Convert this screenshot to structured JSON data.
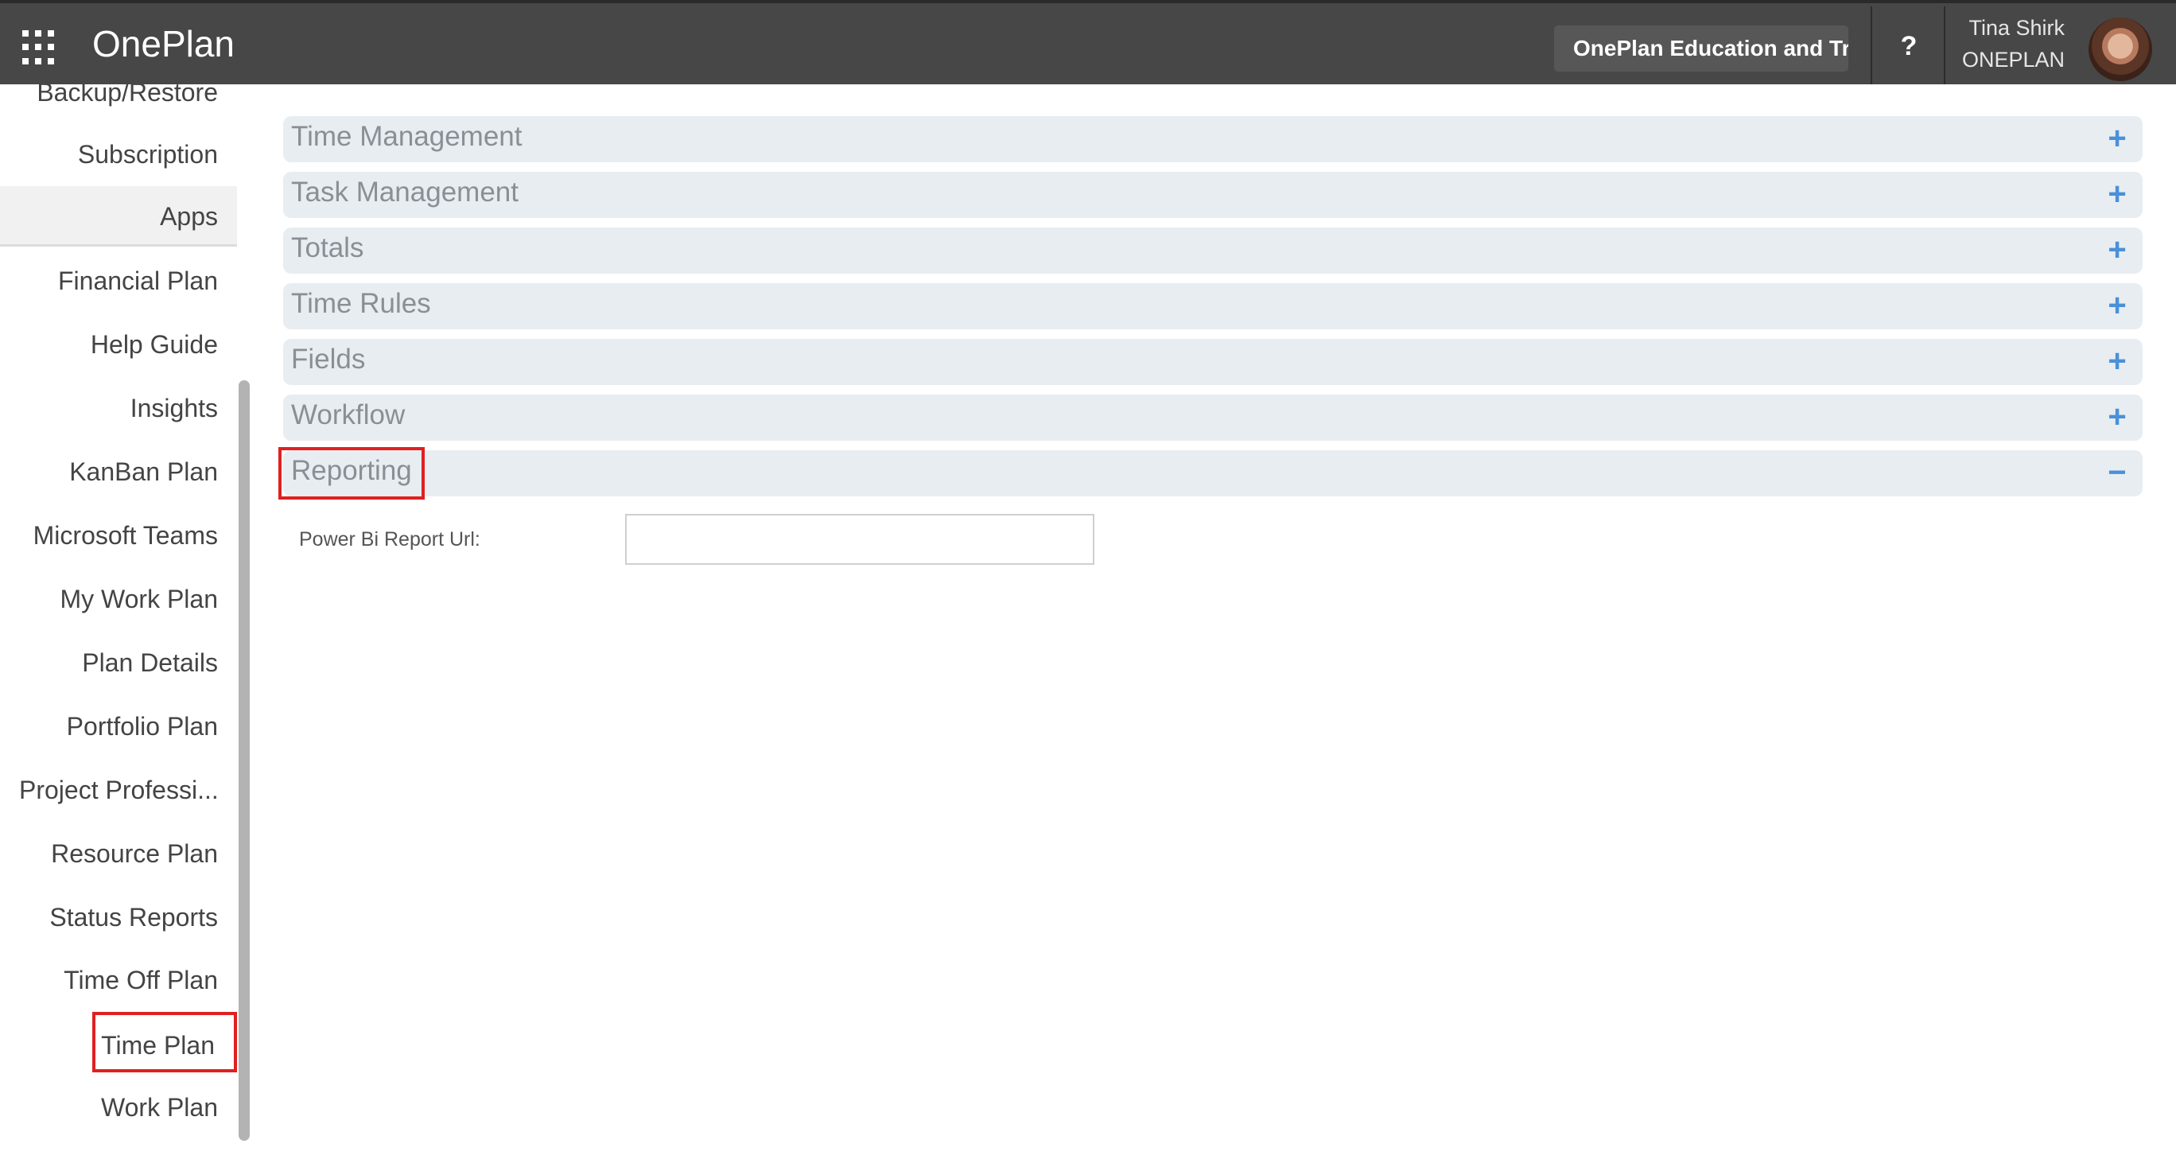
{
  "header": {
    "app_name": "OnePlan",
    "tenant": "OnePlan Education and Trai",
    "help_label": "?",
    "user_name": "Tina Shirk",
    "user_org": "ONEPLAN"
  },
  "sidebar": {
    "items": [
      {
        "label": "Backup/Restore"
      },
      {
        "label": "Subscription"
      },
      {
        "label": "Apps"
      },
      {
        "label": "Financial Plan"
      },
      {
        "label": "Help Guide"
      },
      {
        "label": "Insights"
      },
      {
        "label": "KanBan Plan"
      },
      {
        "label": "Microsoft Teams"
      },
      {
        "label": "My Work Plan"
      },
      {
        "label": "Plan Details"
      },
      {
        "label": "Portfolio Plan"
      },
      {
        "label": "Project Professi..."
      },
      {
        "label": "Resource Plan"
      },
      {
        "label": "Status Reports"
      },
      {
        "label": "Time Off Plan"
      },
      {
        "label": "Time Plan"
      },
      {
        "label": "Work Plan"
      }
    ],
    "active": "Apps",
    "highlighted": "Time Plan"
  },
  "accordion": {
    "sections": [
      {
        "title": "Time Management",
        "icon": "+"
      },
      {
        "title": "Task Management",
        "icon": "+"
      },
      {
        "title": "Totals",
        "icon": "+"
      },
      {
        "title": "Time Rules",
        "icon": "+"
      },
      {
        "title": "Fields",
        "icon": "+"
      },
      {
        "title": "Workflow",
        "icon": "+"
      },
      {
        "title": "Reporting",
        "icon": "−"
      }
    ],
    "open_section": "Reporting"
  },
  "reporting": {
    "label": "Power Bi Report Url:",
    "value": ""
  },
  "colors": {
    "topbar": "#474747",
    "accent_icon": "#4a90d9",
    "highlight": "#e02020",
    "section_bg": "#e8edf1"
  }
}
